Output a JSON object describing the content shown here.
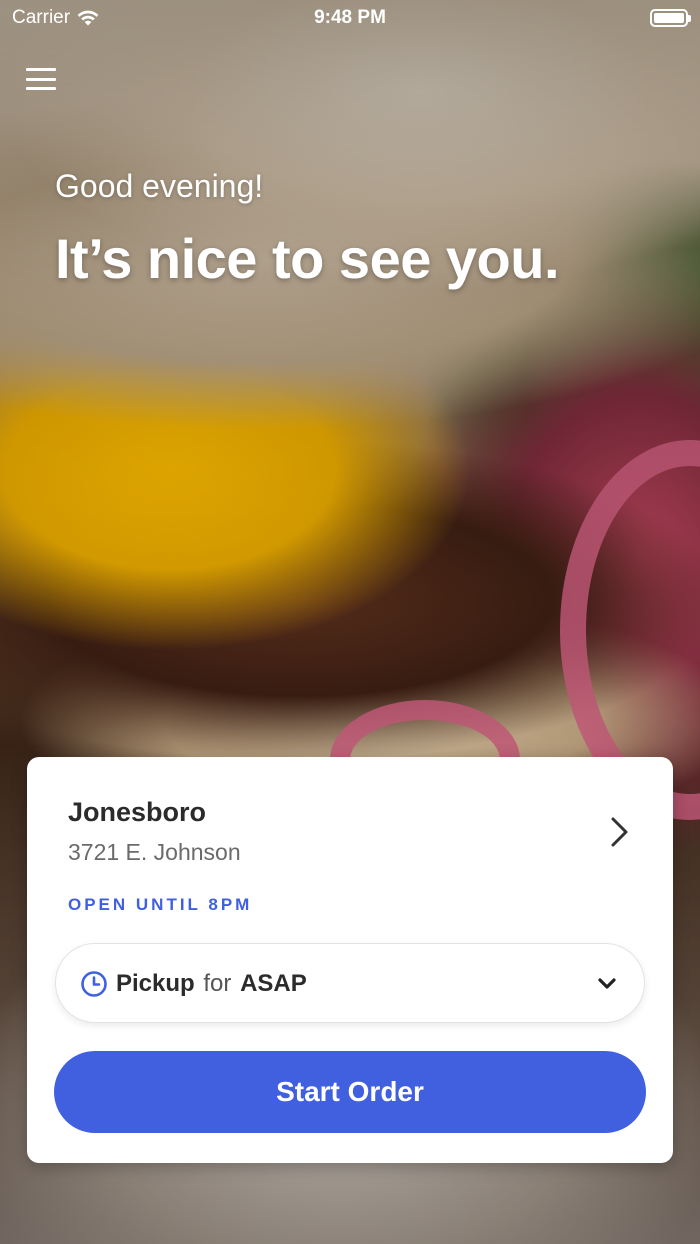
{
  "status_bar": {
    "carrier": "Carrier",
    "time": "9:48 PM",
    "wifi_icon": "wifi-icon",
    "battery_icon": "battery-icon"
  },
  "header": {
    "menu_icon": "hamburger-menu-icon",
    "greeting": "Good evening!",
    "headline": "It’s nice to see you."
  },
  "location_card": {
    "store_name": "Jonesboro",
    "store_address": "3721 E. Johnson",
    "hours": "OPEN UNTIL 8PM",
    "chevron_icon": "chevron-right-icon",
    "order_type": {
      "icon": "clock-icon",
      "mode": "Pickup",
      "connector": "for",
      "time": "ASAP",
      "dropdown_icon": "chevron-down-icon"
    },
    "start_button_label": "Start Order"
  },
  "colors": {
    "accent": "#4160e0",
    "text_dark": "#2b2b2b",
    "text_muted": "#6a6a6a",
    "card_bg": "#ffffff"
  }
}
